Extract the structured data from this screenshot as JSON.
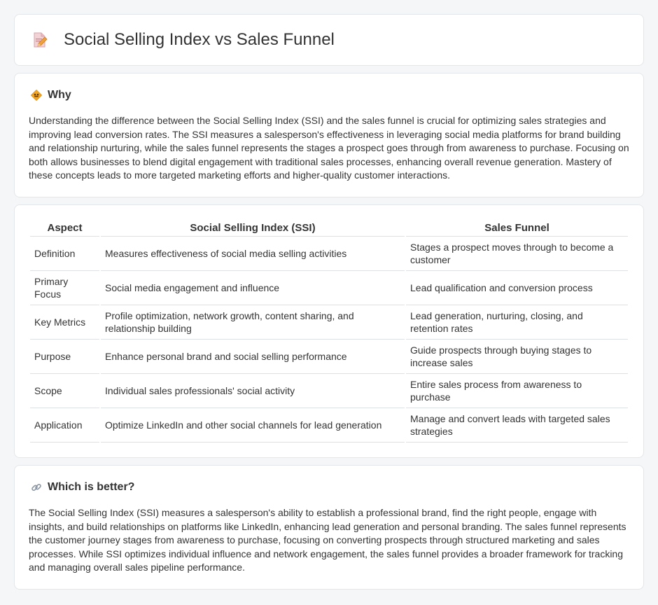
{
  "page": {
    "title": "Social Selling Index vs Sales Funnel"
  },
  "why": {
    "title": "Why",
    "text": "Understanding the difference between the Social Selling Index (SSI) and the sales funnel is crucial for optimizing sales strategies and improving lead conversion rates. The SSI measures a salesperson's effectiveness in leveraging social media platforms for brand building and relationship nurturing, while the sales funnel represents the stages a prospect goes through from awareness to purchase. Focusing on both allows businesses to blend digital engagement with traditional sales processes, enhancing overall revenue generation. Mastery of these concepts leads to more targeted marketing efforts and higher-quality customer interactions."
  },
  "comparison": {
    "headers": [
      "Aspect",
      "Social Selling Index (SSI)",
      "Sales Funnel"
    ],
    "rows": [
      [
        "Definition",
        "Measures effectiveness of social media selling activities",
        "Stages a prospect moves through to become a customer"
      ],
      [
        "Primary Focus",
        "Social media engagement and influence",
        "Lead qualification and conversion process"
      ],
      [
        "Key Metrics",
        "Profile optimization, network growth, content sharing, and relationship building",
        "Lead generation, nurturing, closing, and retention rates"
      ],
      [
        "Purpose",
        "Enhance personal brand and social selling performance",
        "Guide prospects through buying stages to increase sales"
      ],
      [
        "Scope",
        "Individual sales professionals' social activity",
        "Entire sales process from awareness to purchase"
      ],
      [
        "Application",
        "Optimize LinkedIn and other social channels for lead generation",
        "Manage and convert leads with targeted sales strategies"
      ]
    ]
  },
  "better": {
    "title": "Which is better?",
    "text": "The Social Selling Index (SSI) measures a salesperson's ability to establish a professional brand, find the right people, engage with insights, and build relationships on platforms like LinkedIn, enhancing lead generation and personal branding. The sales funnel represents the customer journey stages from awareness to purchase, focusing on converting prospects through structured marketing and sales processes. While SSI optimizes individual influence and network engagement, the sales funnel provides a broader framework for tracking and managing overall sales pipeline performance."
  },
  "icons": {
    "header": "document-pencil-icon",
    "why": "diamond-sign-icon",
    "better": "link-icon"
  }
}
